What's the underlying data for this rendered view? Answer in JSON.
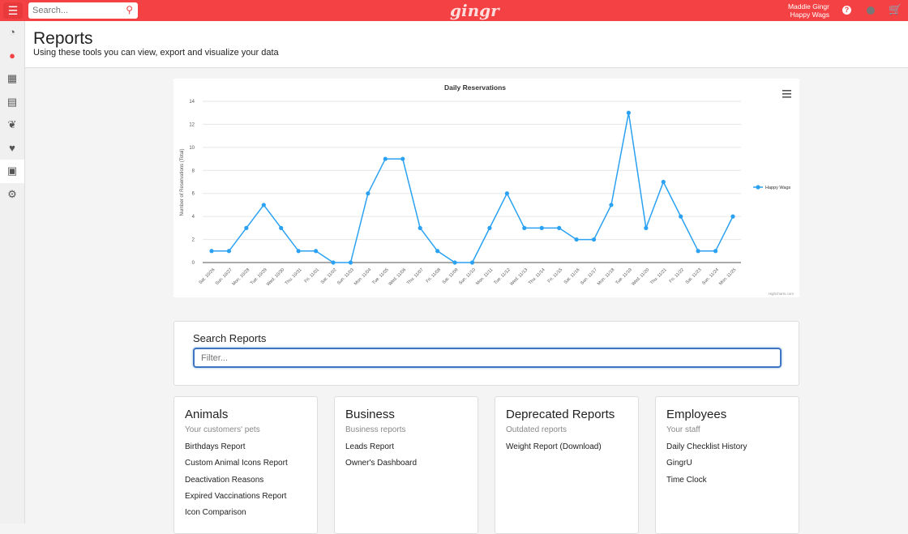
{
  "header": {
    "search_placeholder": "Search...",
    "logo": "gingr",
    "user_name": "Maddie Gingr",
    "user_location": "Happy Wags",
    "help": "?"
  },
  "sidebar": {
    "items": [
      "dashboard-icon",
      "clock-icon",
      "calendar-icon",
      "grid-icon",
      "paw-icon",
      "heart-icon",
      "book-icon",
      "gears-icon"
    ],
    "active": 6
  },
  "page": {
    "title": "Reports",
    "subtitle": "Using these tools you can view, export and visualize your data"
  },
  "chart_data": {
    "type": "line",
    "title": "Daily Reservations",
    "ylabel": "Number of Reservations (Total)",
    "xlabel": "",
    "ylim": [
      0,
      14
    ],
    "yticks": [
      0,
      2,
      4,
      6,
      8,
      10,
      12,
      14
    ],
    "legend": "right",
    "grid": true,
    "credit": "Highcharts.com",
    "color": "#2aa1f2",
    "categories": [
      "Sat. 10/26",
      "Sun. 10/27",
      "Mon. 10/28",
      "Tue. 10/29",
      "Wed. 10/30",
      "Thu. 10/31",
      "Fri. 11/01",
      "Sat. 11/02",
      "Sun. 11/03",
      "Mon. 11/04",
      "Tue. 11/05",
      "Wed. 11/06",
      "Thu. 11/07",
      "Fri. 11/08",
      "Sat. 11/09",
      "Sun. 11/10",
      "Mon. 11/11",
      "Tue. 11/12",
      "Wed. 11/13",
      "Thu. 11/14",
      "Fri. 11/15",
      "Sat. 11/16",
      "Sun. 11/17",
      "Mon. 11/18",
      "Tue. 11/19",
      "Wed. 11/20",
      "Thu. 11/21",
      "Fri. 11/22",
      "Sat. 11/23",
      "Sun. 11/24",
      "Mon. 11/25"
    ],
    "series": [
      {
        "name": "Happy Wags",
        "values": [
          1,
          1,
          3,
          5,
          3,
          1,
          1,
          0,
          0,
          6,
          9,
          9,
          3,
          1,
          0,
          0,
          3,
          6,
          3,
          3,
          3,
          2,
          2,
          5,
          13,
          3,
          7,
          4,
          1,
          1,
          4
        ]
      }
    ]
  },
  "search": {
    "title": "Search Reports",
    "placeholder": "Filter..."
  },
  "cards": [
    {
      "title": "Animals",
      "subtitle": "Your customers' pets",
      "links": [
        "Birthdays Report",
        "Custom Animal Icons Report",
        "Deactivation Reasons",
        "Expired Vaccinations Report",
        "Icon Comparison"
      ]
    },
    {
      "title": "Business",
      "subtitle": "Business reports",
      "links": [
        "Leads Report",
        "Owner's Dashboard"
      ]
    },
    {
      "title": "Deprecated Reports",
      "subtitle": "Outdated reports",
      "links": [
        "Weight Report (Download)"
      ]
    },
    {
      "title": "Employees",
      "subtitle": "Your staff",
      "links": [
        "Daily Checklist History",
        "GingrU",
        "Time Clock"
      ]
    }
  ]
}
